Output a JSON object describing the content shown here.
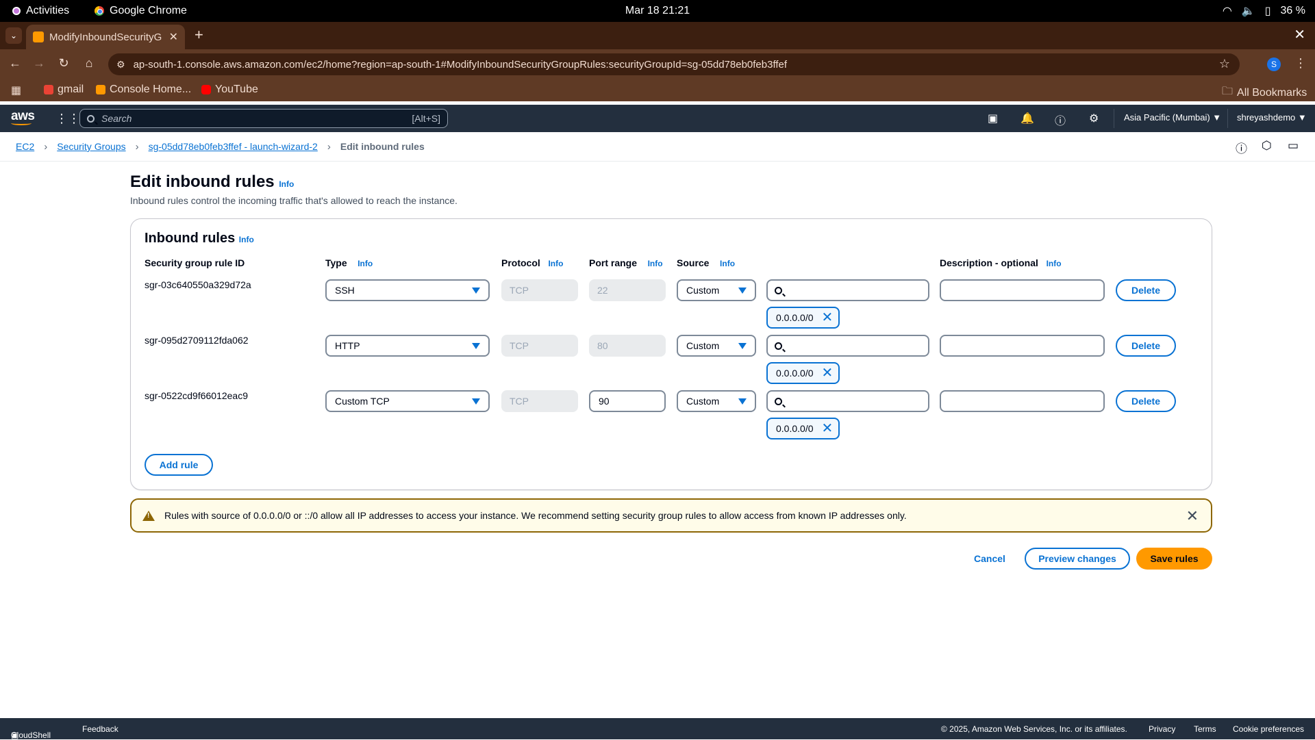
{
  "system": {
    "activities": "Activities",
    "app_name": "Google Chrome",
    "clock": "Mar 18  21:21",
    "battery": "36 %"
  },
  "browser": {
    "tab_title": "ModifyInboundSecurityG",
    "url": "ap-south-1.console.aws.amazon.com/ec2/home?region=ap-south-1#ModifyInboundSecurityGroupRules:securityGroupId=sg-05dd78eb0feb3ffef",
    "profile_initial": "S",
    "bookmarks": [
      {
        "label": "gmail"
      },
      {
        "label": "Console Home..."
      },
      {
        "label": "YouTube"
      }
    ],
    "all_bookmarks": "All Bookmarks"
  },
  "aws_nav": {
    "logo": "aws",
    "search_placeholder": "Search",
    "search_shortcut": "[Alt+S]",
    "region": "Asia Pacific (Mumbai) ▼",
    "account": "shreyashdemo ▼"
  },
  "breadcrumb": {
    "items": [
      "EC2",
      "Security Groups",
      "sg-05dd78eb0feb3ffef - launch-wizard-2"
    ],
    "current": "Edit inbound rules"
  },
  "page": {
    "title": "Edit inbound rules",
    "info": "Info",
    "subtitle": "Inbound rules control the incoming traffic that's allowed to reach the instance."
  },
  "inbound": {
    "heading": "Inbound rules",
    "columns": {
      "rule_id": "Security group rule ID",
      "type": "Type",
      "protocol": "Protocol",
      "port_range": "Port range",
      "source": "Source",
      "description": "Description - optional"
    },
    "rules": [
      {
        "id": "sgr-03c640550a329d72a",
        "type": "SSH",
        "protocol": "TCP",
        "port": "22",
        "source": "Custom",
        "cidr": "0.0.0.0/0",
        "delete": "Delete"
      },
      {
        "id": "sgr-095d2709112fda062",
        "type": "HTTP",
        "protocol": "TCP",
        "port": "80",
        "source": "Custom",
        "cidr": "0.0.0.0/0",
        "delete": "Delete"
      },
      {
        "id": "sgr-0522cd9f66012eac9",
        "type": "Custom TCP",
        "protocol": "TCP",
        "port": "90",
        "source": "Custom",
        "cidr": "0.0.0.0/0",
        "delete": "Delete"
      }
    ],
    "add_rule": "Add rule"
  },
  "alert": {
    "text": "Rules with source of 0.0.0.0/0 or ::/0 allow all IP addresses to access your instance. We recommend setting security group rules to allow access from known IP addresses only."
  },
  "actions": {
    "cancel": "Cancel",
    "preview": "Preview changes",
    "save": "Save rules"
  },
  "footer": {
    "cloudshell": "CloudShell",
    "feedback": "Feedback",
    "copyright": "© 2025, Amazon Web Services, Inc. or its affiliates.",
    "privacy": "Privacy",
    "terms": "Terms",
    "cookies": "Cookie preferences"
  },
  "colors": {
    "aws_nav": "#232f3e",
    "link": "#0972d3",
    "primary": "#ff9900",
    "warning": "#8d6605"
  }
}
